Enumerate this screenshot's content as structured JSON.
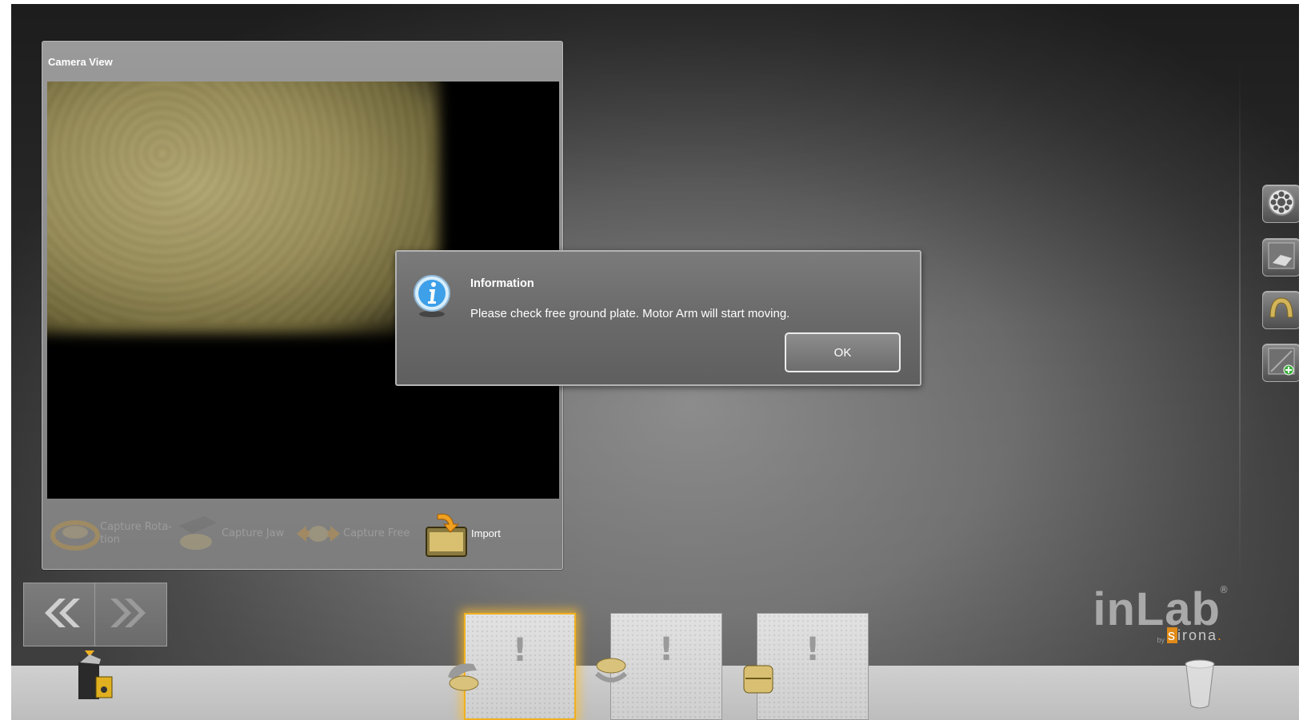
{
  "camera_panel": {
    "title": "Camera View",
    "capture_buttons": [
      {
        "label": "Capture Rota-\ntion",
        "enabled": false,
        "icon": "rotation-capture-icon"
      },
      {
        "label": "Capture Jaw",
        "enabled": false,
        "icon": "jaw-capture-icon"
      },
      {
        "label": "Capture Free",
        "enabled": false,
        "icon": "free-capture-icon"
      },
      {
        "label": "Import",
        "enabled": true,
        "icon": "import-icon"
      }
    ]
  },
  "dialog": {
    "title": "Information",
    "message": "Please check free ground plate. Motor Arm will start moving.",
    "ok_label": "OK",
    "icon": "info-icon"
  },
  "right_toolbar": {
    "buttons": [
      "gear-wheel-icon",
      "scan-tray-icon",
      "bridge-model-icon",
      "add-model-icon"
    ]
  },
  "nav": {
    "prev_icon": "double-chevron-left-icon",
    "next_icon": "double-chevron-right-icon"
  },
  "slots": [
    {
      "mark": "!",
      "active": true,
      "thumb": "lower-jaw-model-icon"
    },
    {
      "mark": "!",
      "active": false,
      "thumb": "upper-jaw-model-icon"
    },
    {
      "mark": "!",
      "active": false,
      "thumb": "bite-model-icon"
    }
  ],
  "logo": {
    "main": "inLab",
    "reg": "®",
    "by": "by",
    "brand_first": "s",
    "brand_rest": "irona",
    "brand_dot": "."
  },
  "colors": {
    "accent": "#f0b020",
    "dialog_bg": "#6e6e6e",
    "brand_orange": "#e08a18"
  }
}
